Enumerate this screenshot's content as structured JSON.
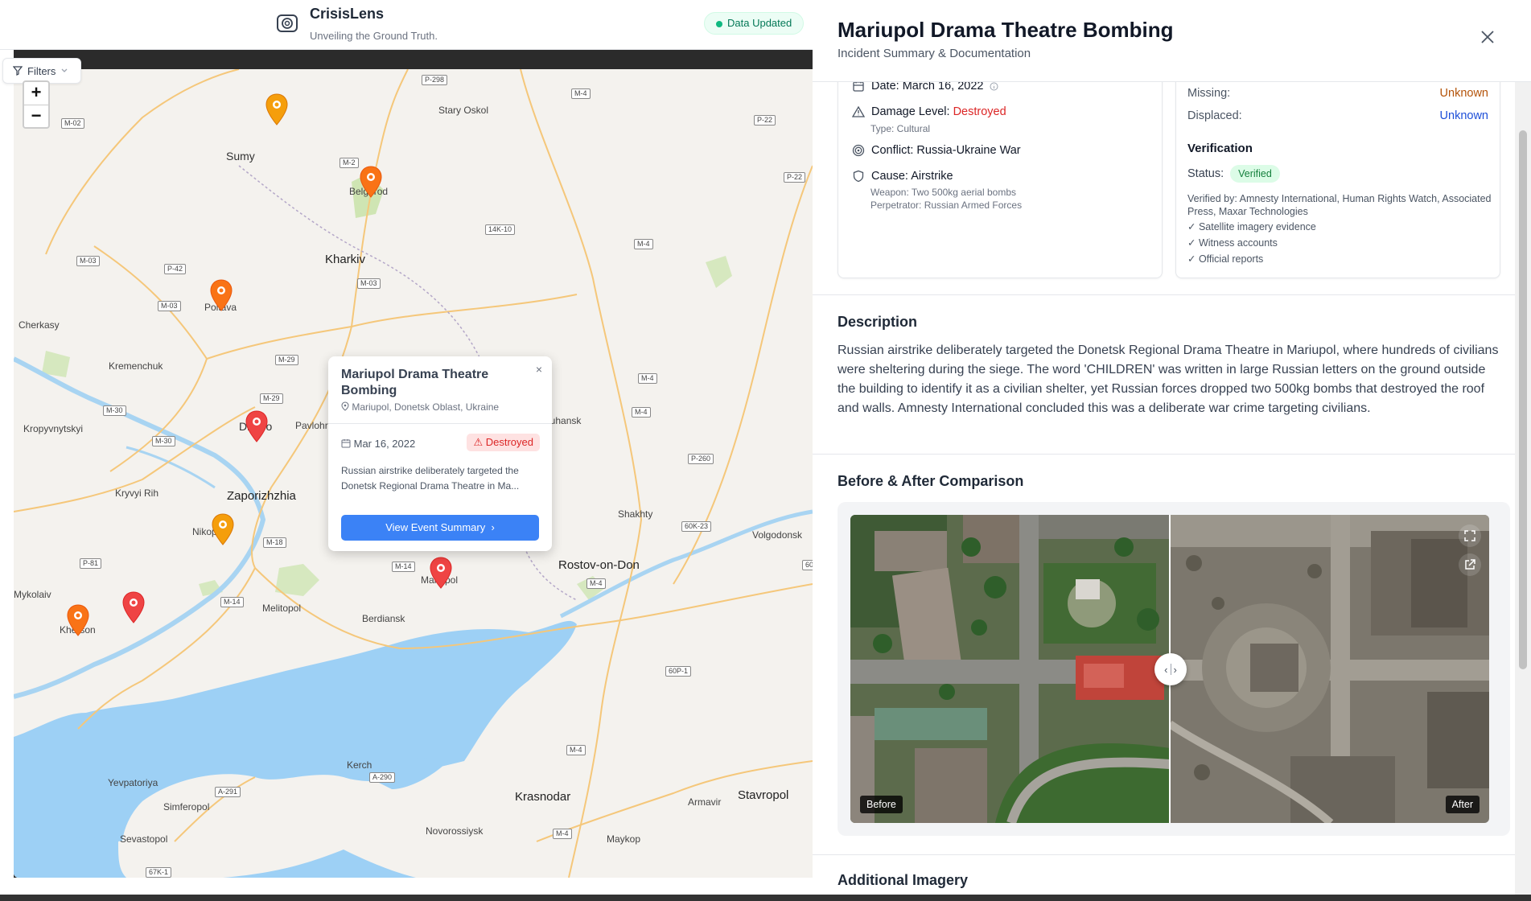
{
  "app": {
    "name": "CrisisLens",
    "tagline": "Unveiling the Ground Truth.",
    "status": "Data Updated"
  },
  "map": {
    "filters_label": "Filters",
    "zoom_in": "+",
    "zoom_out": "−",
    "cities": [
      "Stary Oskol",
      "Sumy",
      "Belgorod",
      "Kharkiv",
      "Poltava",
      "Cherkasy",
      "Kremenchuk",
      "Kropyvnytskyi",
      "Dnipro",
      "Pavlohr",
      "Luhansk",
      "Zaporizhzhia",
      "Kryvyi Rih",
      "Nikopol",
      "Shakhty",
      "Volgodonsk",
      "Rostov-on-Don",
      "Mariupol",
      "Mykolaiv",
      "Kherson",
      "Melitopol",
      "Berdiansk",
      "Kerch",
      "Yevpatoriya",
      "Simferopol",
      "Sevastopol",
      "Krasnodar",
      "Armavir",
      "Stavropol",
      "Novorossiysk",
      "Maykop"
    ],
    "roads": [
      "P-298",
      "M-4",
      "M-02",
      "P-22",
      "M-2",
      "P-22",
      "14K-10",
      "M-4",
      "M-03",
      "P-42",
      "M-03",
      "M-03",
      "M-29",
      "M-29",
      "M-30",
      "M-30",
      "P-260",
      "M-4",
      "M-4",
      "60K-23",
      "M-18",
      "P-81",
      "M-14",
      "M-14",
      "M-4",
      "60P-1",
      "M-4",
      "A-290",
      "A-291",
      "M-4",
      "67K-1",
      "60"
    ]
  },
  "popup": {
    "title": "Mariupol Drama Theatre Bombing",
    "location": "Mariupol, Donetsk Oblast, Ukraine",
    "date": "Mar 16, 2022",
    "badge": "Destroyed",
    "description": "Russian airstrike deliberately targeted the Donetsk Regional Drama Theatre in Ma...",
    "button": "View Event Summary",
    "close": "×"
  },
  "panel": {
    "title": "Mariupol Drama Theatre Bombing",
    "subtitle": "Incident Summary & Documentation",
    "details": {
      "date_label": "Date:",
      "date_value": "March 16, 2022",
      "damage_label": "Damage Level:",
      "damage_value": "Destroyed",
      "type": "Type: Cultural",
      "conflict_label": "Conflict:",
      "conflict_value": "Russia-Ukraine War",
      "cause_label": "Cause:",
      "cause_value": "Airstrike",
      "weapon": "Weapon: Two 500kg aerial bombs",
      "perpetrator": "Perpetrator: Russian Armed Forces"
    },
    "casualties": {
      "missing_label": "Missing:",
      "missing_value": "Unknown",
      "displaced_label": "Displaced:",
      "displaced_value": "Unknown"
    },
    "verification": {
      "title": "Verification",
      "status_label": "Status:",
      "status_value": "Verified",
      "verified_by": "Verified by: Amnesty International, Human Rights Watch, Associated Press, Maxar Technologies",
      "evidence": [
        "✓ Satellite imagery evidence",
        "✓ Witness accounts",
        "✓ Official reports"
      ]
    },
    "description_title": "Description",
    "description": "Russian airstrike deliberately targeted the Donetsk Regional Drama Theatre in Mariupol, where hundreds of civilians were sheltering during the siege. The word 'CHILDREN' was written in large Russian letters on the ground outside the building to identify it as a civilian shelter, yet Russian forces dropped two 500kg bombs that destroyed the roof and walls. Amnesty International concluded this was a deliberate war crime targeting civilians.",
    "comparison_title": "Before & After Comparison",
    "before_label": "Before",
    "after_label": "After",
    "additional_title": "Additional Imagery"
  },
  "colors": {
    "accent": "#3b82f6",
    "danger": "#dc2626",
    "success": "#15803d",
    "pin_orange": "#f59e0b",
    "pin_red": "#ef4444"
  }
}
